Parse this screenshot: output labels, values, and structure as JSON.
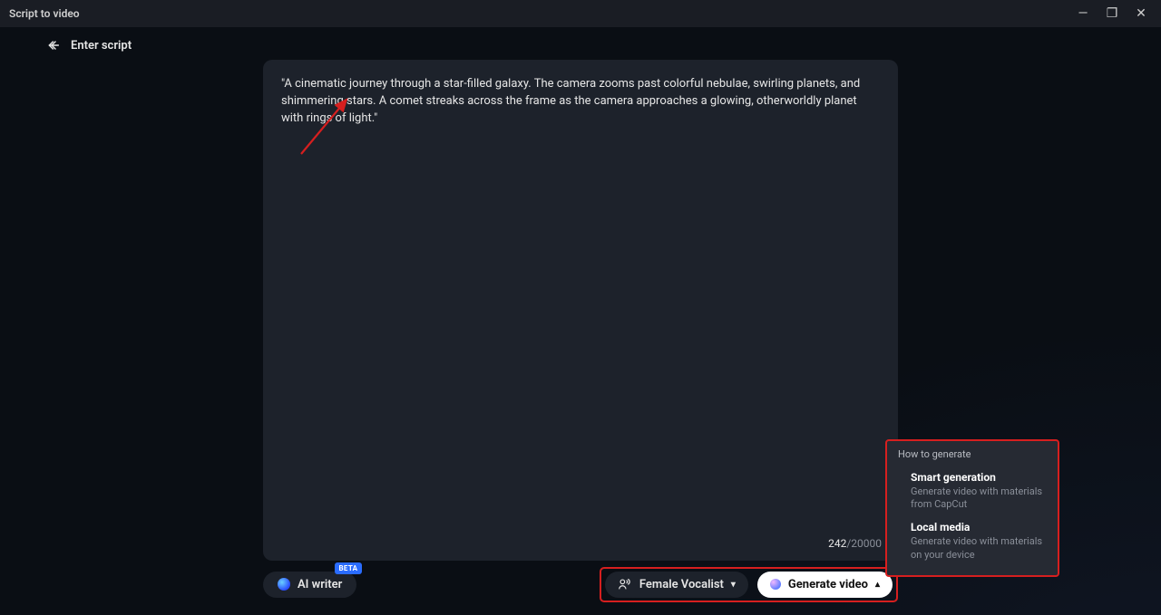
{
  "titlebar": {
    "title": "Script to video"
  },
  "window_controls": {
    "minimize_label": "—",
    "maximize_label": "❐",
    "close_label": "✕"
  },
  "header": {
    "back_label": "Enter script"
  },
  "script": {
    "text": "\"A cinematic journey through a star-filled galaxy. The camera zooms past colorful nebulae, swirling planets, and shimmering stars. A comet streaks across the frame as the camera approaches a glowing, otherworldly planet with rings of light.\""
  },
  "counter": {
    "current": "242",
    "sep": "/",
    "max": "20000"
  },
  "footer": {
    "ai_writer_label": "AI writer",
    "beta_label": "BETA",
    "voice_label": "Female Vocalist",
    "generate_label": "Generate video"
  },
  "popup": {
    "title": "How to generate",
    "items": [
      {
        "title": "Smart generation",
        "desc": "Generate video with materials from CapCut"
      },
      {
        "title": "Local media",
        "desc": "Generate video with materials on your device"
      }
    ]
  }
}
